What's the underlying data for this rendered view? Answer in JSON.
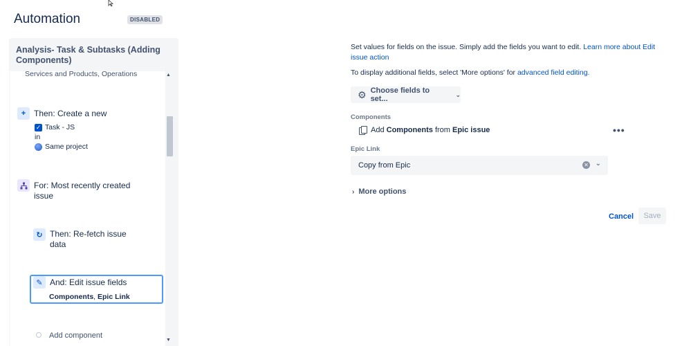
{
  "header": {
    "title": "Automation",
    "badge": "DISABLED"
  },
  "rule": {
    "title": "Analysis-  Task & Subtasks (Adding Components)",
    "clipped_text": "Services and Products, Operations",
    "steps": {
      "create": {
        "prefix": "Then:",
        "label": "Then: Create a new",
        "issue_type": "Task - JS",
        "in": "in",
        "project": "Same project"
      },
      "for": {
        "label": "For: Most recently created issue"
      },
      "refetch": {
        "label": "Then: Re-fetch issue data"
      },
      "edit": {
        "label": "And: Edit issue fields",
        "field1": "Components",
        "sep": ", ",
        "field2": "Epic Link"
      },
      "add": {
        "label": "Add component"
      }
    }
  },
  "config": {
    "desc_line1": "Set values for fields on the issue. Simply add the fields you want to edit. ",
    "desc_link1": "Learn more about Edit issue action",
    "desc_line2": "To display additional fields, select 'More options' for ",
    "desc_link2": "advanced field editing.",
    "choose_label": "Choose fields to set...",
    "components_label": "Components",
    "components_add": "Add",
    "components_field": "Components",
    "components_from": "from",
    "components_source": "Epic issue",
    "epic_label": "Epic Link",
    "epic_value": "Copy from Epic",
    "more_options": "More options",
    "cancel": "Cancel",
    "save": "Save"
  },
  "colors": {
    "accent": "#0052cc",
    "focus": "#4c9aff",
    "panel": "#f4f5f7"
  }
}
